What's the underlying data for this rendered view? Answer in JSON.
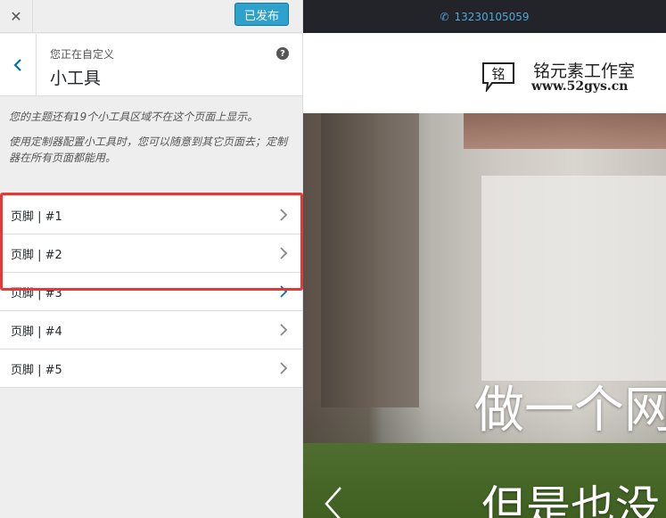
{
  "sidebar": {
    "close_label": "✕",
    "publish_label": "已发布",
    "customizing_label": "您正在自定义",
    "section_title": "小工具",
    "help_label": "?",
    "notice": [
      "您的主题还有19个小工具区域不在这个页面上显示。",
      "使用定制器配置小工具时，您可以随意到其它页面去；定制器在所有页面都能用。"
    ],
    "areas": [
      {
        "label": "页脚 | #1"
      },
      {
        "label": "页脚 | #2"
      },
      {
        "label": "页脚 | #3"
      },
      {
        "label": "页脚 | #4"
      },
      {
        "label": "页脚 | #5"
      }
    ]
  },
  "preview": {
    "phone": "13230105059",
    "logo_char": "铭",
    "site_name": "铭元素工作室",
    "site_url": "www.52gys.cn",
    "hero_line1": "做一个网",
    "hero_line2": "但是也没"
  },
  "colors": {
    "publish": "#2ea2cc",
    "highlight": "#e53935",
    "topbar": "#23242a",
    "phone": "#4ea7d8"
  }
}
